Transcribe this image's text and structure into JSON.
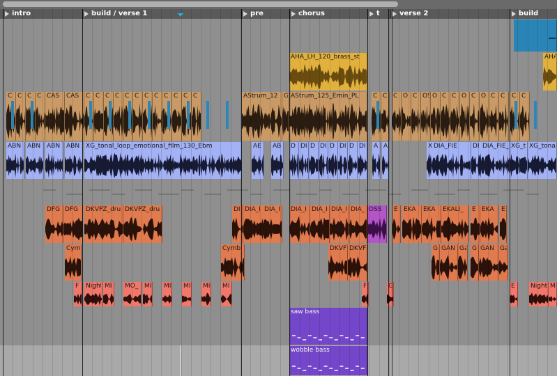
{
  "scroll_position": 0.71,
  "locators": [
    "intro",
    "build / verse 1",
    "pre",
    "chorus",
    "t",
    "verse 2",
    "build"
  ],
  "tracks": [
    {
      "clips": [
        {
          "label": "",
          "color": "#2a85b6",
          "wave": "#1b5e82"
        }
      ]
    },
    {
      "clips": [
        {
          "label": "AHA_LH_120_brass_st",
          "color": "#e2b13d",
          "wave": "#6a4c0f"
        },
        {
          "label": "AHA",
          "color": "#e2b13d",
          "wave": "#6a4c0f"
        }
      ]
    },
    {
      "clips": [
        {
          "label": "C",
          "color": "#c99a66",
          "wave": "#2a1c10"
        },
        {
          "label": "C",
          "color": "#c99a66",
          "wave": "#2a1c10"
        },
        {
          "label": "C",
          "color": "#c99a66",
          "wave": "#2a1c10"
        },
        {
          "label": "C",
          "color": "#c99a66",
          "wave": "#2a1c10"
        },
        {
          "label": "CAS",
          "color": "#c99a66",
          "wave": "#2a1c10"
        },
        {
          "label": "CAS",
          "color": "#c99a66",
          "wave": "#2a1c10"
        },
        {
          "label": "C",
          "color": "#c99a66",
          "wave": "#2a1c10"
        },
        {
          "label": "C",
          "color": "#c99a66",
          "wave": "#2a1c10"
        },
        {
          "label": "C",
          "color": "#c99a66",
          "wave": "#2a1c10"
        },
        {
          "label": "C",
          "color": "#c99a66",
          "wave": "#2a1c10"
        },
        {
          "label": "C",
          "color": "#c99a66",
          "wave": "#2a1c10"
        },
        {
          "label": "C",
          "color": "#c99a66",
          "wave": "#2a1c10"
        },
        {
          "label": "C",
          "color": "#c99a66",
          "wave": "#2a1c10"
        },
        {
          "label": "C",
          "color": "#c99a66",
          "wave": "#2a1c10"
        },
        {
          "label": "C",
          "color": "#c99a66",
          "wave": "#2a1c10"
        },
        {
          "label": "C",
          "color": "#c99a66",
          "wave": "#2a1c10"
        },
        {
          "label": "C",
          "color": "#c99a66",
          "wave": "#2a1c10"
        },
        {
          "label": "C",
          "color": "#c99a66",
          "wave": "#2a1c10"
        },
        {
          "label": "AStrum_12",
          "color": "#c99a66",
          "wave": "#2a1c10"
        },
        {
          "label": "G",
          "color": "#c99a66",
          "wave": "#2a1c10"
        },
        {
          "label": "AStrum_125_Emin_PL",
          "color": "#c99a66",
          "wave": "#2a1c10"
        },
        {
          "label": "C",
          "color": "#c99a66",
          "wave": "#2a1c10"
        },
        {
          "label": "C",
          "color": "#c99a66",
          "wave": "#2a1c10"
        },
        {
          "label": "C",
          "color": "#c99a66",
          "wave": "#2a1c10"
        },
        {
          "label": "O",
          "color": "#c99a66",
          "wave": "#2a1c10"
        },
        {
          "label": "C",
          "color": "#c99a66",
          "wave": "#2a1c10"
        },
        {
          "label": "OS",
          "color": "#c99a66",
          "wave": "#2a1c10"
        },
        {
          "label": "O",
          "color": "#c99a66",
          "wave": "#2a1c10"
        },
        {
          "label": "C",
          "color": "#c99a66",
          "wave": "#2a1c10"
        },
        {
          "label": "C",
          "color": "#c99a66",
          "wave": "#2a1c10"
        },
        {
          "label": "O",
          "color": "#c99a66",
          "wave": "#2a1c10"
        },
        {
          "label": "C",
          "color": "#c99a66",
          "wave": "#2a1c10"
        },
        {
          "label": "O",
          "color": "#c99a66",
          "wave": "#2a1c10"
        },
        {
          "label": "C",
          "color": "#c99a66",
          "wave": "#2a1c10"
        },
        {
          "label": "C",
          "color": "#c99a66",
          "wave": "#2a1c10"
        },
        {
          "label": "C",
          "color": "#c99a66",
          "wave": "#2a1c10"
        },
        {
          "label": "C",
          "color": "#c99a66",
          "wave": "#2a1c10"
        }
      ]
    },
    {
      "clips": [
        {
          "label": "ABN",
          "color": "#a3b1f5",
          "wave": "#161a33"
        },
        {
          "label": "ABN",
          "color": "#a3b1f5",
          "wave": "#161a33"
        },
        {
          "label": "ABN",
          "color": "#a3b1f5",
          "wave": "#161a33"
        },
        {
          "label": "ABN",
          "color": "#a3b1f5",
          "wave": "#161a33"
        },
        {
          "label": "XG_tonal_loop_emotional_film_130_Ebm",
          "color": "#a3b1f5",
          "wave": "#161a33"
        },
        {
          "label": "AE",
          "color": "#a3b1f5",
          "wave": "#161a33"
        },
        {
          "label": "AB",
          "color": "#a3b1f5",
          "wave": "#161a33"
        },
        {
          "label": "D",
          "color": "#a3b1f5",
          "wave": "#161a33"
        },
        {
          "label": "DI",
          "color": "#a3b1f5",
          "wave": "#161a33"
        },
        {
          "label": "D",
          "color": "#a3b1f5",
          "wave": "#161a33"
        },
        {
          "label": "DI",
          "color": "#a3b1f5",
          "wave": "#161a33"
        },
        {
          "label": "D",
          "color": "#a3b1f5",
          "wave": "#161a33"
        },
        {
          "label": "DI",
          "color": "#a3b1f5",
          "wave": "#161a33"
        },
        {
          "label": "D",
          "color": "#a3b1f5",
          "wave": "#161a33"
        },
        {
          "label": "DI",
          "color": "#a3b1f5",
          "wave": "#161a33"
        },
        {
          "label": "A",
          "color": "#a3b1f5",
          "wave": "#161a33"
        },
        {
          "label": "A",
          "color": "#a3b1f5",
          "wave": "#161a33"
        },
        {
          "label": "X",
          "color": "#a3b1f5",
          "wave": "#161a33"
        },
        {
          "label": "DIA_FIE",
          "color": "#a3b1f5",
          "wave": "#161a33"
        },
        {
          "label": "DI",
          "color": "#a3b1f5",
          "wave": "#161a33"
        },
        {
          "label": "DIA_FIE_8E",
          "color": "#a3b1f5",
          "wave": "#161a33"
        },
        {
          "label": "XG_t",
          "color": "#a3b1f5",
          "wave": "#161a33"
        },
        {
          "label": "XG_tona",
          "color": "#a3b1f5",
          "wave": "#161a33"
        }
      ]
    },
    {
      "clips": []
    },
    {
      "clips": [
        {
          "label": "DFG",
          "color": "#e07a4f",
          "wave": "#2a120a"
        },
        {
          "label": "DFG",
          "color": "#e07a4f",
          "wave": "#2a120a"
        },
        {
          "label": "DKVPZ_dru",
          "color": "#e07a4f",
          "wave": "#2a120a"
        },
        {
          "label": "DKVPZ_dru",
          "color": "#e07a4f",
          "wave": "#2a120a"
        },
        {
          "label": "DI",
          "color": "#e07a4f",
          "wave": "#2a120a"
        },
        {
          "label": "DIA_I",
          "color": "#e07a4f",
          "wave": "#2a120a"
        },
        {
          "label": "DIA_I",
          "color": "#e07a4f",
          "wave": "#2a120a"
        },
        {
          "label": "DIA_I",
          "color": "#e07a4f",
          "wave": "#2a120a"
        },
        {
          "label": "DIA_I",
          "color": "#e07a4f",
          "wave": "#2a120a"
        },
        {
          "label": "DIA_I",
          "color": "#e07a4f",
          "wave": "#2a120a"
        },
        {
          "label": "DIA_",
          "color": "#e07a4f",
          "wave": "#2a120a"
        },
        {
          "label": "OSS",
          "color": "#b255c6",
          "wave": "#3c0f49"
        },
        {
          "label": "E",
          "color": "#e07a4f",
          "wave": "#2a120a"
        },
        {
          "label": "EKA",
          "color": "#e07a4f",
          "wave": "#2a120a"
        },
        {
          "label": "EKA",
          "color": "#e07a4f",
          "wave": "#2a120a"
        },
        {
          "label": "EKALI_",
          "color": "#e07a4f",
          "wave": "#2a120a"
        },
        {
          "label": "E",
          "color": "#e07a4f",
          "wave": "#2a120a"
        },
        {
          "label": "EKA",
          "color": "#e07a4f",
          "wave": "#2a120a"
        },
        {
          "label": "E",
          "color": "#e07a4f",
          "wave": "#2a120a"
        }
      ]
    },
    {
      "clips": [
        {
          "label": "Cym",
          "color": "#e07a4f",
          "wave": "#2a120a"
        },
        {
          "label": "Cymb",
          "color": "#e07a4f",
          "wave": "#2a120a"
        },
        {
          "label": "DKVF",
          "color": "#e07a4f",
          "wave": "#2a120a"
        },
        {
          "label": "DKVF",
          "color": "#e07a4f",
          "wave": "#2a120a"
        },
        {
          "label": "G",
          "color": "#e07a4f",
          "wave": "#2a120a"
        },
        {
          "label": "GAN",
          "color": "#e07a4f",
          "wave": "#2a120a"
        },
        {
          "label": "Ga",
          "color": "#e07a4f",
          "wave": "#2a120a"
        },
        {
          "label": "G",
          "color": "#e07a4f",
          "wave": "#2a120a"
        },
        {
          "label": "GAN",
          "color": "#e07a4f",
          "wave": "#2a120a"
        },
        {
          "label": "Ga",
          "color": "#e07a4f",
          "wave": "#2a120a"
        }
      ]
    },
    {
      "clips": [
        {
          "label": "F",
          "color": "#f0776a",
          "wave": "#2e0f0b"
        },
        {
          "label": "Night",
          "color": "#f0776a",
          "wave": "#2e0f0b"
        },
        {
          "label": "MI",
          "color": "#f0776a",
          "wave": "#2e0f0b"
        },
        {
          "label": "MO_",
          "color": "#f0776a",
          "wave": "#2e0f0b"
        },
        {
          "label": "MI",
          "color": "#f0776a",
          "wave": "#2e0f0b"
        },
        {
          "label": "MI",
          "color": "#f0776a",
          "wave": "#2e0f0b"
        },
        {
          "label": "MI",
          "color": "#f0776a",
          "wave": "#2e0f0b"
        },
        {
          "label": "MI",
          "color": "#f0776a",
          "wave": "#2e0f0b"
        },
        {
          "label": "MI",
          "color": "#f0776a",
          "wave": "#2e0f0b"
        },
        {
          "label": "F",
          "color": "#f0776a",
          "wave": "#2e0f0b"
        },
        {
          "label": "G",
          "color": "#f0776a",
          "wave": "#2e0f0b"
        },
        {
          "label": "E",
          "color": "#f0776a",
          "wave": "#2e0f0b"
        },
        {
          "label": "Night",
          "color": "#f0776a",
          "wave": "#2e0f0b"
        },
        {
          "label": "M",
          "color": "#f0776a",
          "wave": "#2e0f0b"
        }
      ]
    },
    {
      "clips": [
        {
          "label": "saw bass",
          "color": "#7446c9",
          "wave": "#d9ccf5"
        }
      ]
    },
    {
      "clips": [
        {
          "label": "wobble bass",
          "color": "#7446c9",
          "wave": "#d9ccf5"
        }
      ]
    }
  ]
}
